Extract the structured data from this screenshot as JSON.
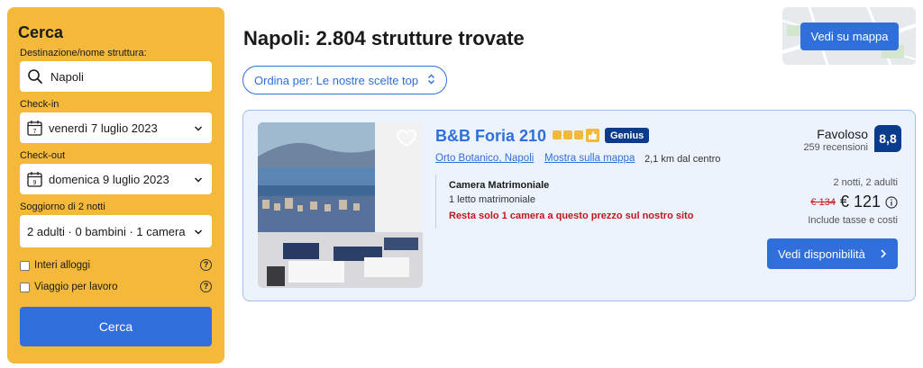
{
  "sidebar": {
    "title": "Cerca",
    "destination_label": "Destinazione/nome struttura:",
    "destination_value": "Napoli",
    "checkin_label": "Check-in",
    "checkin_value": "venerdì 7 luglio 2023",
    "checkin_day": "7",
    "checkout_label": "Check-out",
    "checkout_value": "domenica 9 luglio 2023",
    "checkout_day": "9",
    "stay_label": "Soggiorno di 2 notti",
    "guests_value": "2 adulti · 0 bambini · 1 camera",
    "filter_whole": "Interi alloggi",
    "filter_business": "Viaggio per lavoro",
    "search_button": "Cerca"
  },
  "header": {
    "title": "Napoli: 2.804 strutture trovate",
    "sort_label": "Ordina per: Le nostre scelte top",
    "map_button": "Vedi su mappa"
  },
  "result": {
    "name": "B&B Foria 210",
    "genius": "Genius",
    "district": "Orto Botanico, Napoli",
    "map_link": "Mostra sulla mappa",
    "distance": "2,1 km dal centro",
    "room_name": "Camera Matrimoniale",
    "bed": "1 letto matrimoniale",
    "scarcity": "Resta solo 1 camera a questo prezzo sul nostro sito",
    "rating_word": "Favoloso",
    "reviews": "259 recensioni",
    "score": "8,8",
    "stay": "2 notti, 2 adulti",
    "old_price": "€ 134",
    "price": "€ 121",
    "taxes": "Include tasse e costi",
    "availability_button": "Vedi disponibilità"
  },
  "colors": {
    "brand_blue": "#2f6fdc",
    "sidebar_yellow": "#f4b93a",
    "score_navy": "#0b3b8c",
    "alert_red": "#c4151a"
  },
  "icons": [
    "search-icon",
    "calendar-icon",
    "chevron-down-icon",
    "info-icon",
    "updown-icon",
    "heart-icon",
    "chevron-right-icon"
  ]
}
